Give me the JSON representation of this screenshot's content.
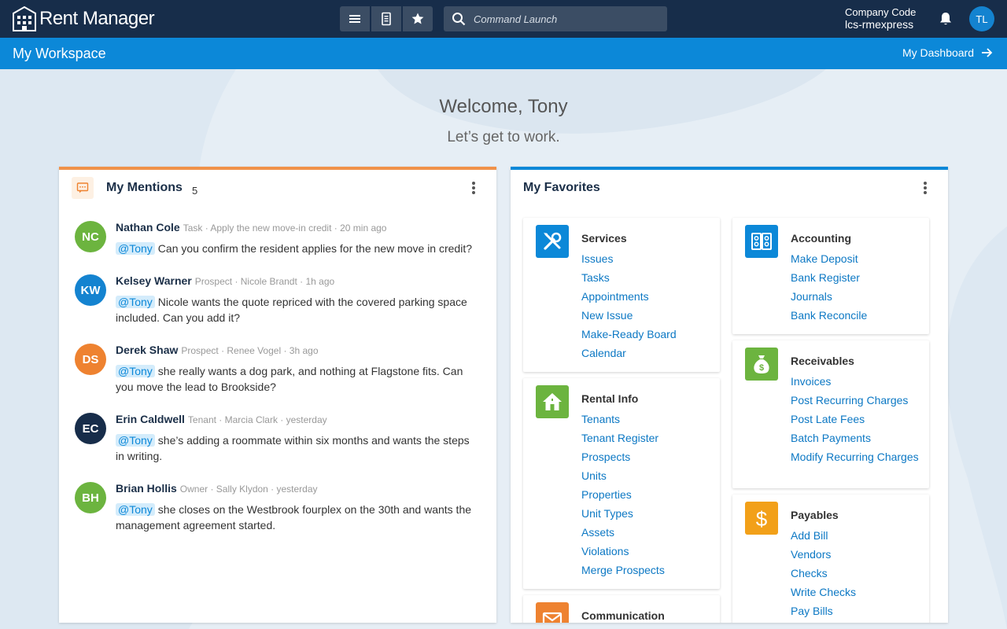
{
  "header": {
    "logo_text": "Rent Manager",
    "search_placeholder": "Command Launch",
    "company_label": "Company Code",
    "company_value": "lcs-rmexpress",
    "user_initials": "TL"
  },
  "workspace": {
    "title": "My Workspace",
    "dashboard_link": "My Dashboard"
  },
  "welcome": {
    "greeting": "Welcome, Tony",
    "tagline": "Let’s get to work."
  },
  "mentions": {
    "title": "My Mentions",
    "count": "5",
    "items": [
      {
        "initials": "NC",
        "color": "#6cb43f",
        "name": "Nathan Cole",
        "meta": "Task · Apply the new move-in credit · 20 min ago",
        "tag": "@Tony",
        "text": "Can you confirm the resident applies for the new move in credit?"
      },
      {
        "initials": "KW",
        "color": "#1483d0",
        "name": "Kelsey Warner",
        "meta": "Prospect · Nicole Brandt · 1h ago",
        "tag": "@Tony",
        "text": "Nicole wants the quote repriced with the covered parking space included. Can you add it?"
      },
      {
        "initials": "DS",
        "color": "#ee8230",
        "name": "Derek Shaw",
        "meta": "Prospect · Renee Vogel · 3h ago",
        "tag": "@Tony",
        "text": "she really wants a dog park, and nothing at Flagstone fits. Can you move the lead to Brookside?"
      },
      {
        "initials": "EC",
        "color": "#172d4a",
        "name": "Erin Caldwell",
        "meta": "Tenant · Marcia Clark · yesterday",
        "tag": "@Tony",
        "text": "she’s adding a roommate within six months and wants the steps in writing."
      },
      {
        "initials": "BH",
        "color": "#6cb43f",
        "name": "Brian Hollis",
        "meta": "Owner · Sally Klydon · yesterday",
        "tag": "@Tony",
        "text": "she closes on the Westbrook fourplex on the 30th and wants the management agreement started."
      }
    ]
  },
  "favorites": {
    "title": "My Favorites",
    "cards": [
      {
        "id": "services",
        "title": "Services",
        "icon": "tools-icon",
        "color": "#0c88d8",
        "links": [
          "Issues",
          "Tasks",
          "Appointments",
          "New Issue",
          "Make-Ready Board",
          "Calendar"
        ]
      },
      {
        "id": "rental-info",
        "title": "Rental Info",
        "icon": "house-icon",
        "color": "#6cb43f",
        "links": [
          "Tenants",
          "Tenant Register",
          "Prospects",
          "Units",
          "Properties",
          "Unit Types",
          "Assets",
          "Violations",
          "Merge Prospects"
        ]
      },
      {
        "id": "communication",
        "title": "Communication",
        "icon": "envelope-icon",
        "color": "#ee8230",
        "links": []
      },
      {
        "id": "accounting",
        "title": "Accounting",
        "icon": "ledger-icon",
        "color": "#0c88d8",
        "links": [
          "Make Deposit",
          "Bank Register",
          "Journals",
          "Bank Reconcile"
        ]
      },
      {
        "id": "receivables",
        "title": "Receivables",
        "icon": "money-bag-icon",
        "color": "#6cb43f",
        "links": [
          "Invoices",
          "Post Recurring Charges",
          "Post Late Fees",
          "Batch Payments",
          "Modify Recurring Charges"
        ]
      },
      {
        "id": "payables",
        "title": "Payables",
        "icon": "dollar-icon",
        "color": "#f2a019",
        "links": [
          "Add Bill",
          "Vendors",
          "Checks",
          "Write Checks",
          "Pay Bills"
        ]
      }
    ]
  }
}
